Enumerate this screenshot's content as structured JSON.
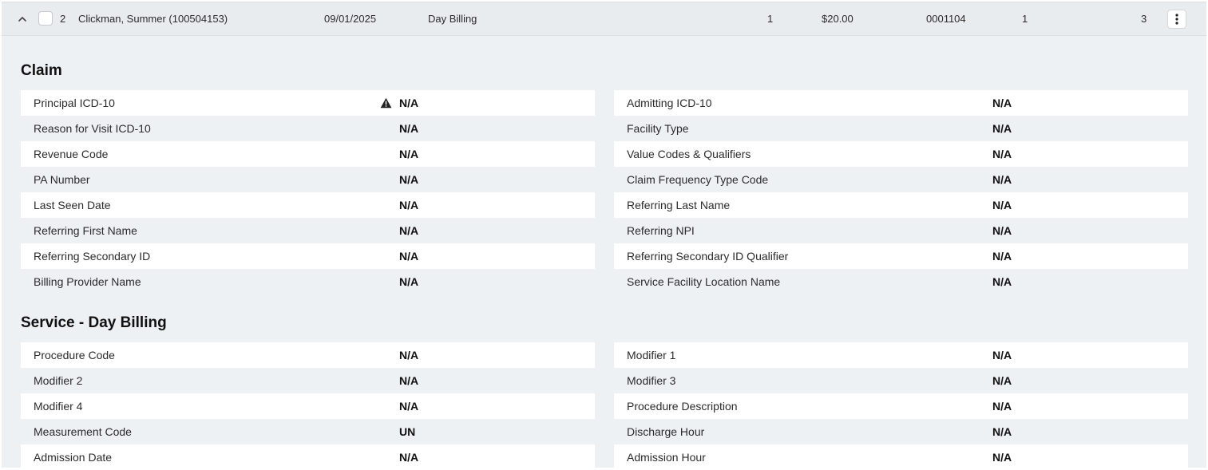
{
  "row": {
    "index": "2",
    "name": "Clickman, Summer (100504153)",
    "date": "09/01/2025",
    "type": "Day Billing",
    "units": "1",
    "amount": "$20.00",
    "code": "0001104",
    "col7": "1",
    "col8": "3"
  },
  "claim": {
    "title": "Claim",
    "left": [
      {
        "label": "Principal ICD-10",
        "value": "N/A",
        "warning": true
      },
      {
        "label": "Reason for Visit ICD-10",
        "value": "N/A"
      },
      {
        "label": "Revenue Code",
        "value": "N/A"
      },
      {
        "label": "PA Number",
        "value": "N/A"
      },
      {
        "label": "Last Seen Date",
        "value": "N/A"
      },
      {
        "label": "Referring First Name",
        "value": "N/A"
      },
      {
        "label": "Referring Secondary ID",
        "value": "N/A"
      },
      {
        "label": "Billing Provider Name",
        "value": "N/A"
      }
    ],
    "right": [
      {
        "label": "Admitting ICD-10",
        "value": "N/A"
      },
      {
        "label": "Facility Type",
        "value": "N/A"
      },
      {
        "label": "Value Codes & Qualifiers",
        "value": "N/A"
      },
      {
        "label": "Claim Frequency Type Code",
        "value": "N/A"
      },
      {
        "label": "Referring Last Name",
        "value": "N/A"
      },
      {
        "label": "Referring NPI",
        "value": "N/A"
      },
      {
        "label": "Referring Secondary ID Qualifier",
        "value": "N/A"
      },
      {
        "label": "Service Facility Location Name",
        "value": "N/A"
      }
    ]
  },
  "service": {
    "title": "Service - Day Billing",
    "left": [
      {
        "label": "Procedure Code",
        "value": "N/A"
      },
      {
        "label": "Modifier 2",
        "value": "N/A"
      },
      {
        "label": "Modifier 4",
        "value": "N/A"
      },
      {
        "label": "Measurement Code",
        "value": "UN"
      },
      {
        "label": "Admission Date",
        "value": "N/A"
      }
    ],
    "right": [
      {
        "label": "Modifier 1",
        "value": "N/A"
      },
      {
        "label": "Modifier 3",
        "value": "N/A"
      },
      {
        "label": "Procedure Description",
        "value": "N/A"
      },
      {
        "label": "Discharge Hour",
        "value": "N/A"
      },
      {
        "label": "Admission Hour",
        "value": "N/A"
      }
    ]
  },
  "icons": {
    "collapse": "chevron-up-icon",
    "menu": "kebab-menu-icon",
    "warning": "warning-triangle-icon"
  },
  "colors": {
    "header_bg": "#e9ecef",
    "panel_bg": "#eef1f4",
    "row_light": "#ffffff"
  }
}
